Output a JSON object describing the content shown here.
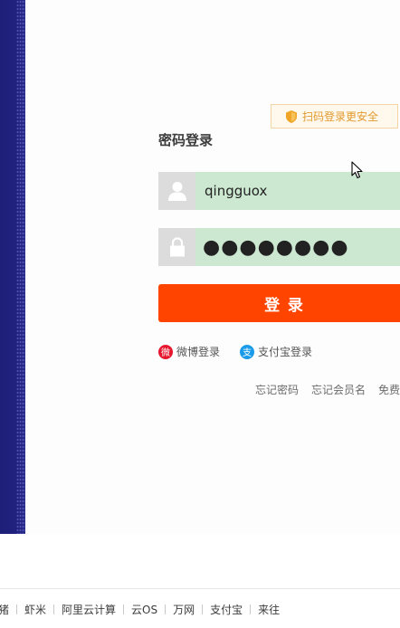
{
  "qr_tip": {
    "label": "扫码登录更安全",
    "icon": "shield-icon"
  },
  "login": {
    "title": "密码登录",
    "username_value": "qingguox",
    "password_value": "●●●●●●●●",
    "submit_label": "登 录"
  },
  "third_party": [
    {
      "label": "微博登录",
      "icon": "weibo-icon",
      "glyph": "微"
    },
    {
      "label": "支付宝登录",
      "icon": "alipay-icon",
      "glyph": "支"
    }
  ],
  "help_links": [
    "忘记密码",
    "忘记会员名",
    "免费"
  ],
  "footer_links": [
    "猪",
    "虾米",
    "阿里云计算",
    "云OS",
    "万网",
    "支付宝",
    "来往"
  ],
  "colors": {
    "accent": "#ff4400",
    "input_fill": "#cce8d1",
    "banner": "#21227e",
    "tip_text": "#e09a2f"
  }
}
